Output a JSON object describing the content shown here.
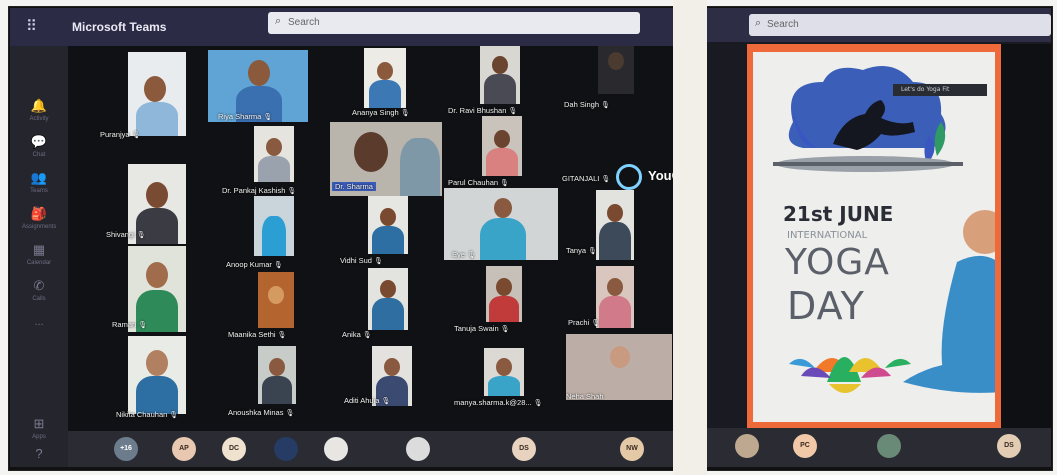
{
  "teams": {
    "app_title": "Microsoft Teams",
    "search_placeholder": "Search",
    "apps_icon": "grid-icon",
    "rail": [
      {
        "icon": "activity-icon",
        "label": "Activity"
      },
      {
        "icon": "chat-icon",
        "label": "Chat"
      },
      {
        "icon": "teams-icon",
        "label": "Teams"
      },
      {
        "icon": "assignments-icon",
        "label": "Assignments"
      },
      {
        "icon": "calendar-icon",
        "label": "Calendar"
      },
      {
        "icon": "calls-icon",
        "label": "Calls"
      },
      {
        "icon": "more-icon",
        "label": "..."
      },
      {
        "icon": "apps-store-icon",
        "label": "Apps"
      },
      {
        "icon": "help-icon",
        "label": ""
      }
    ],
    "participants": [
      {
        "name": "Puranjya"
      },
      {
        "name": "Riya Sharma"
      },
      {
        "name": "Ananya Singh"
      },
      {
        "name": "Dr. Ravi Bhushan"
      },
      {
        "name": "Dah Singh"
      },
      {
        "name": "Dr. Pankaj Kashish"
      },
      {
        "name": "Dr. Sharma"
      },
      {
        "name": "Parul Chauhan"
      },
      {
        "name": "GITANJALI"
      },
      {
        "name": "Shivangi"
      },
      {
        "name": "Anoop Kumar"
      },
      {
        "name": "Vidhi Sud"
      },
      {
        "name": "Eye"
      },
      {
        "name": "Tanya"
      },
      {
        "name": "Raman"
      },
      {
        "name": "Maanika Sethi"
      },
      {
        "name": "Anika"
      },
      {
        "name": "Tanuja Swain"
      },
      {
        "name": "Prachi"
      },
      {
        "name": "Nikita Chauhan"
      },
      {
        "name": "Anoushka Minas"
      },
      {
        "name": "Aditi Ahuja"
      },
      {
        "name": "manya.sharma.k@28..."
      },
      {
        "name": "Neha Shah"
      }
    ],
    "youcam_label": "YouCam",
    "bottom_avatars": [
      "+16",
      "AP",
      "DC",
      "",
      "",
      "",
      "DS",
      "NW"
    ]
  },
  "right_window": {
    "search_placeholder": "Search",
    "poster": {
      "banner": "Let's do Yoga Fit",
      "date": "21st JUNE",
      "line2": "INTERNATIONAL",
      "line3": "YOGA",
      "line4": "DAY"
    },
    "bottom_avatars": [
      "",
      "PC",
      "",
      "DS"
    ]
  }
}
